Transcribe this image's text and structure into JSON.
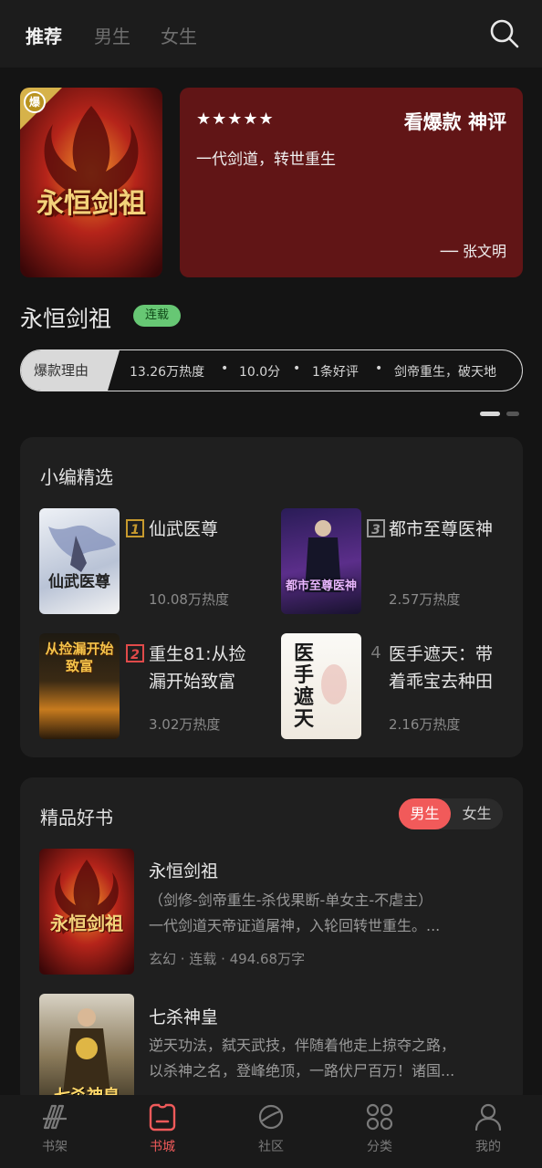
{
  "top_tabs": [
    "推荐",
    "男生",
    "女生"
  ],
  "featured": {
    "cover_badge": "爆",
    "cover_title": "永恒剑祖",
    "rating_stars": "★★★★★",
    "review_heading": "看爆款 神评",
    "review_text": "一代剑道，转世重生",
    "review_author": "── 张文明",
    "book_title": "永恒剑祖",
    "status": "连载",
    "reason_label": "爆款理由",
    "reasons": [
      "13.26万热度",
      "10.0分",
      "1条好评",
      "剑帝重生，破天地"
    ]
  },
  "editor_picks": {
    "title": "小编精选",
    "items": [
      {
        "rank": "1",
        "title_lines": [
          "仙武医尊"
        ],
        "heat": "10.08万热度",
        "cover_text": "仙武医尊"
      },
      {
        "rank": "3",
        "title_lines": [
          "都市至尊医神"
        ],
        "heat": "2.57万热度",
        "cover_text": "都市至尊医神"
      },
      {
        "rank": "2",
        "title_lines": [
          "重生81:从捡",
          "漏开始致富"
        ],
        "heat": "3.02万热度",
        "cover_text": "从捡漏开始致富"
      },
      {
        "rank": "4",
        "title_lines": [
          "医手遮天：带",
          "着乖宝去种田"
        ],
        "heat": "2.16万热度",
        "cover_text": "医手遮天"
      }
    ]
  },
  "quality_books": {
    "title": "精品好书",
    "gender_options": [
      "男生",
      "女生"
    ],
    "books": [
      {
        "title": "永恒剑祖",
        "desc_lines": [
          "（剑修-剑帝重生-杀伐果断-单女主-不虐主）",
          "一代剑道天帝证道屠神，入轮回转世重生。..."
        ],
        "meta": "玄幻 · 连载 · 494.68万字",
        "cover_text": "永恒剑祖"
      },
      {
        "title": "七杀神皇",
        "desc_lines": [
          "逆天功法，弑天武技，伴随着他走上掠夺之路，",
          "以杀神之名，登峰绝顶，一路伏尸百万！诸国..."
        ],
        "cover_text": "七杀神皇"
      }
    ]
  },
  "bottom_nav": [
    "书架",
    "书城",
    "社区",
    "分类",
    "我的"
  ],
  "colors": {
    "background": "#141414",
    "card": "#1f1f1f",
    "accent_red": "#f15a5a",
    "review_card": "#611516",
    "status_green": "#67c774"
  }
}
